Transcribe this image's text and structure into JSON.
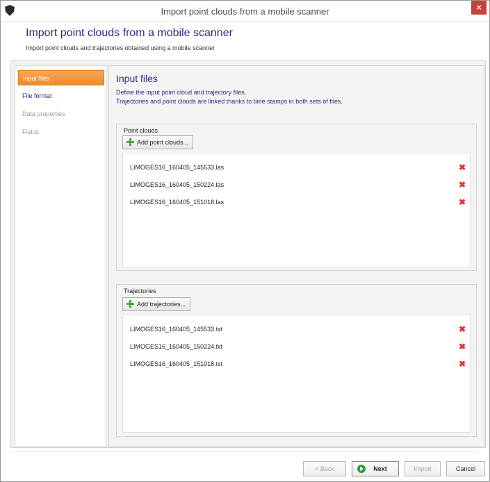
{
  "window": {
    "title": "Import point clouds from a mobile scanner",
    "close_glyph": "×"
  },
  "header": {
    "title": "Import point clouds from a mobile scanner",
    "subtitle": "Import point clouds and trajectories obtained using a mobile scanner"
  },
  "sidebar": {
    "items": [
      {
        "label": "Input files",
        "state": "active"
      },
      {
        "label": "File format",
        "state": "normal"
      },
      {
        "label": "Data properties",
        "state": "disabled"
      },
      {
        "label": "Fields",
        "state": "disabled"
      }
    ]
  },
  "main": {
    "title": "Input files",
    "description": [
      "Define the input point cloud and trajectory files.",
      "Trajectories and point clouds are linked thanks to time stamps in both sets of files."
    ]
  },
  "point_clouds": {
    "label": "Point clouds",
    "add_label": "Add point clouds...",
    "files": [
      "LIMOGES16_160405_145533.las",
      "LIMOGES16_160405_150224.las",
      "LIMOGES16_160405_151018.las"
    ]
  },
  "trajectories": {
    "label": "Trajectories",
    "add_label": "Add trajectories...",
    "files": [
      "LIMOGES16_160405_145533.txt",
      "LIMOGES16_160405_150224.txt",
      "LIMOGES16_160405_151018.txt"
    ]
  },
  "footer": {
    "back_label": "< Back",
    "next_label": "Next",
    "import_label": "Import",
    "cancel_label": "Cancel"
  },
  "icons": {
    "app": "shield-icon",
    "add": "plus-icon",
    "remove": "red-x-icon",
    "next": "green-arrow-circle-icon"
  },
  "colors": {
    "accent": "#f08a2c",
    "title_text": "#2a2a7a",
    "close": "#c9403a",
    "remove": "#dd3333",
    "add": "#3fae3f",
    "next": "#2f9e3a"
  }
}
